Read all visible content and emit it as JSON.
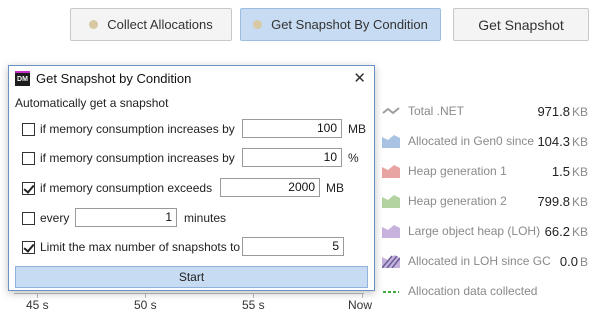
{
  "toolbar": {
    "collect_label": "Collect Allocations",
    "condition_label": "Get Snapshot By Condition",
    "snapshot_label": "Get Snapshot"
  },
  "legend": [
    {
      "label": "Total .NET",
      "value": "971.8",
      "unit": "KB",
      "color": "#9e9e9e",
      "icon": "line-icon"
    },
    {
      "label": "Allocated in Gen0 since",
      "value": "104.3",
      "unit": "KB",
      "color": "#a9c4e2",
      "icon": "area-icon"
    },
    {
      "label": "Heap generation 1",
      "value": "1.5",
      "unit": "KB",
      "color": "#e8a3a3",
      "icon": "area-icon"
    },
    {
      "label": "Heap generation 2",
      "value": "799.8",
      "unit": "KB",
      "color": "#b3d3a0",
      "icon": "area-icon"
    },
    {
      "label": "Large object heap (LOH)",
      "value": "66.2",
      "unit": "KB",
      "color": "#c6b2dd",
      "icon": "area-icon"
    },
    {
      "label": "Allocated in LOH since GC",
      "value": "0.0",
      "unit": "B",
      "color": "#8a7cb5",
      "icon": "hatched-area-icon"
    },
    {
      "label": "Allocation data collected",
      "value": "",
      "unit": "",
      "color": "#3fae3f",
      "icon": "dashed-line-icon"
    }
  ],
  "axis": {
    "ticks": [
      "45 s",
      "50 s",
      "55 s",
      "Now"
    ]
  },
  "dialog": {
    "title": "Get Snapshot by Condition",
    "app_icon_text": "DM",
    "section_label": "Automatically get a snapshot",
    "conditions": [
      {
        "label": "if memory consumption increases by",
        "value": "100",
        "unit": "MB",
        "checked": false
      },
      {
        "label": "if memory consumption increases by",
        "value": "10",
        "unit": "%",
        "checked": false
      },
      {
        "label": "if memory consumption exceeds",
        "value": "2000",
        "unit": "MB",
        "checked": true
      },
      {
        "label": "every",
        "value": "1",
        "unit": "minutes",
        "checked": false
      },
      {
        "label": "Limit the max number of snapshots to",
        "value": "5",
        "unit": "",
        "checked": true
      }
    ],
    "start_label": "Start"
  }
}
